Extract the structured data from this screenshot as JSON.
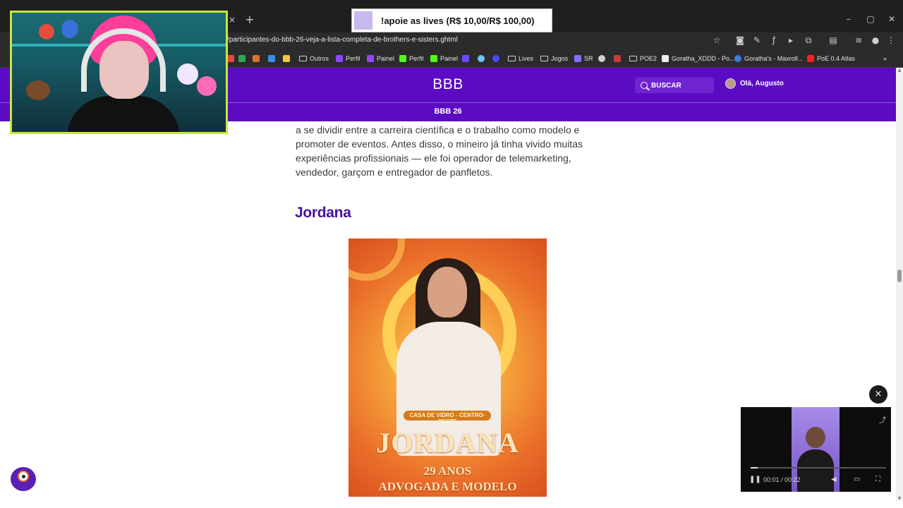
{
  "browser": {
    "tab_close": "×",
    "new_tab": "+",
    "url": "/participantes-do-bbb-26-veja-a-lista-completa-de-brothers-e-sisters.ghtml",
    "window_controls": {
      "minimize": "–",
      "maximize": "▢",
      "close": "✕"
    },
    "bookmarks": [
      {
        "label": "Outros",
        "icon": "folder-icon"
      },
      {
        "label": "Perfil",
        "icon": "twitch-icon"
      },
      {
        "label": "Painel",
        "icon": "twitch-icon"
      },
      {
        "label": "Perfil",
        "icon": "kick-icon"
      },
      {
        "label": "Painel",
        "icon": "kick-icon"
      },
      {
        "label": "Lives",
        "icon": "folder-icon"
      },
      {
        "label": "Jogos",
        "icon": "folder-icon"
      },
      {
        "label": "SR",
        "icon": "sr-icon"
      },
      {
        "label": "POE2",
        "icon": "folder-icon"
      },
      {
        "label": "Goratha_XDDD - Po...",
        "icon": "site-icon"
      },
      {
        "label": "Goratha's - Maxroll...",
        "icon": "site-icon"
      },
      {
        "label": "PoE 0.4 Atlas",
        "icon": "youtube-icon"
      }
    ],
    "bookmarks_more": "»"
  },
  "stream_overlay": {
    "banner_text": "!apoie as lives (R$ 10,00/R$ 100,00)",
    "banner_swatch_color": "#c9b8ef",
    "webcam_border_color": "#c8e63a"
  },
  "site": {
    "logo": "BBB",
    "search_label": "BUSCAR",
    "user_greeting": "Olá, Augusto",
    "subnav": "BBB 26",
    "brand_color": "#5b0bc2"
  },
  "article": {
    "paragraph": "a se dividir entre a carreira científica e o trabalho como modelo e promoter de eventos. Antes disso, o mineiro já tinha vivido muitas experiências profissionais — ele foi operador de telemarketing, vendedor, garçom e entregador de panfletos.",
    "heading": "Jordana",
    "heading_color": "#4a0fa0",
    "photo": {
      "tag": "CASA DE VIDRO - CENTRO-OESTE",
      "name": "JORDANA",
      "age": "29 ANOS",
      "role": "ADVOGADA E MODELO"
    }
  },
  "player": {
    "close_label": "×",
    "time": "00:01 / 00:22",
    "progress": 0.05
  }
}
